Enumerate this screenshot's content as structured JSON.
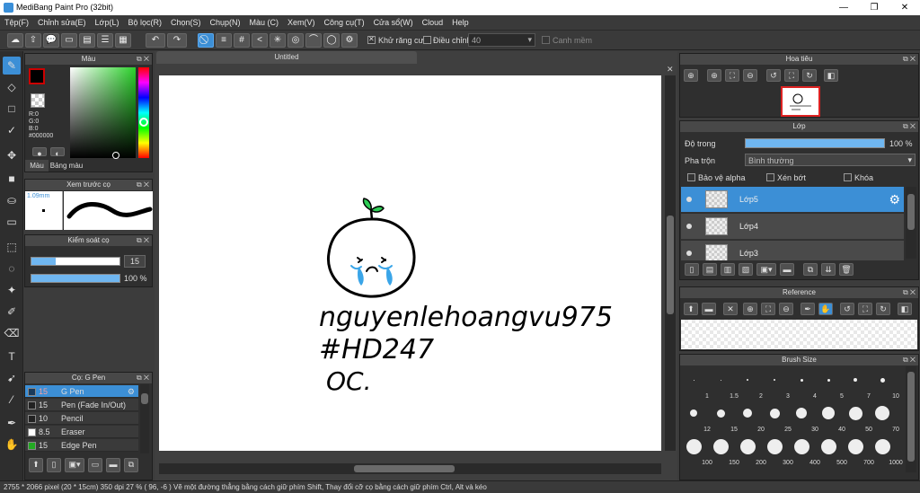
{
  "window": {
    "title": "MediBang Paint Pro (32bit)",
    "minimize": "—",
    "maximize": "❐",
    "close": "✕"
  },
  "menu": [
    "Tệp(F)",
    "Chỉnh sửa(E)",
    "Lớp(L)",
    "Bộ lọc(R)",
    "Chọn(S)",
    "Chụp(N)",
    "Màu (C)",
    "Xem(V)",
    "Công cụ(T)",
    "Cửa sổ(W)",
    "Cloud",
    "Help"
  ],
  "toolbar": {
    "antialias_label": "Khử răng cưa",
    "adjust_label": "Điều chỉnh",
    "adjust_value": "40",
    "snap_label": "Canh mềm"
  },
  "color_panel": {
    "title": "Màu",
    "r": "R:0",
    "g": "G:0",
    "b": "B:0",
    "hex": "#000000",
    "tab_color": "Màu",
    "tab_palette": "Bảng màu",
    "primary_color": "#000000",
    "accent": "#3c8fd6"
  },
  "brush_preview": {
    "title": "Xem trước cọ",
    "size": "1.09mm"
  },
  "brush_control": {
    "title": "Kiểm soát cọ",
    "size_value": "15",
    "opacity_value": "100 %",
    "size_level_percent": 28,
    "opacity_level_percent": 100
  },
  "brush_panel": {
    "title": "Cọ: G Pen",
    "items": [
      {
        "size": "15",
        "name": "G Pen",
        "color": "#1a3a5a",
        "selected": true
      },
      {
        "size": "15",
        "name": "Pen (Fade In/Out)",
        "color": "#222222",
        "selected": false
      },
      {
        "size": "10",
        "name": "Pencil",
        "color": "#222222",
        "selected": false
      },
      {
        "size": "8.5",
        "name": "Eraser",
        "color": "#ffffff",
        "selected": false
      },
      {
        "size": "15",
        "name": "Edge Pen",
        "color": "#22aa22",
        "selected": false
      }
    ]
  },
  "document": {
    "tab_title": "Untitled",
    "canvas_text": {
      "line1": "nguyenlehoangvu975",
      "line2": "#HD247",
      "line3": "OC."
    }
  },
  "navigator": {
    "title": "Hoa tiêu"
  },
  "layer_panel": {
    "title": "Lớp",
    "opacity_label": "Độ trong",
    "opacity_value": "100 %",
    "opacity_level_percent": 100,
    "blend_label": "Pha trộn",
    "blend_value": "Bình thường",
    "protect_alpha": "Bảo vệ alpha",
    "clipping": "Xén bớt",
    "lock": "Khóa",
    "layers": [
      {
        "name": "Lớp5",
        "selected": true
      },
      {
        "name": "Lớp4",
        "selected": false
      },
      {
        "name": "Lớp3",
        "selected": false
      }
    ]
  },
  "reference_panel": {
    "title": "Reference"
  },
  "brush_size_panel": {
    "title": "Brush Size",
    "sizes": [
      "1",
      "1.5",
      "2",
      "3",
      "4",
      "5",
      "7",
      "10",
      "12",
      "15",
      "20",
      "25",
      "30",
      "40",
      "50",
      "70",
      "100",
      "150",
      "200",
      "300",
      "400",
      "500",
      "700",
      "1000"
    ]
  },
  "status": {
    "text": "2755 * 2066 pixel   (20 * 15cm)   350 dpi   27 %   ( 96, -6 )   Vẽ một đường thẳng bằng cách giữ phím Shift, Thay đổi cỡ cọ bằng cách giữ phím Ctrl, Alt và kéo"
  }
}
